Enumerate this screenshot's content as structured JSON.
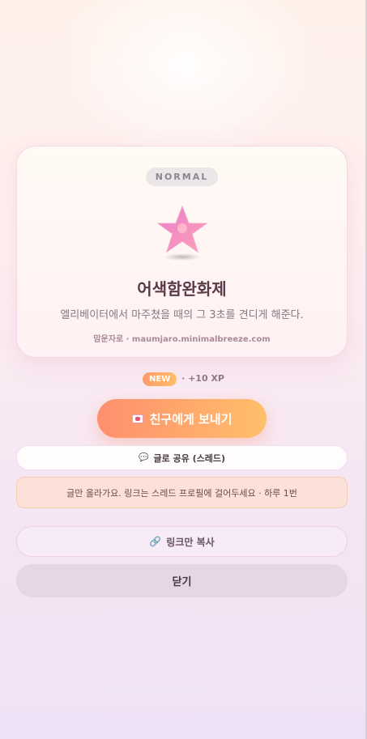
{
  "card": {
    "badge": "NORMAL",
    "title": "어색함완화제",
    "description": "엘리베이터에서 마주쳤을 때의 그 3초를 견디게 해준다.",
    "source": "맘운자로 · maumjaro.minimalbreeze.com",
    "icon": "pink-star-icon"
  },
  "reward": {
    "new_label": "NEW",
    "xp_text": "· +10 XP"
  },
  "actions": {
    "send_label": "친구에게 보내기",
    "share_label": "글로 공유 (스레드)",
    "notice": "글만 올라가요. 링크는 스레드 프로필에 걸어두세요 · 하루 1번",
    "copy_label": "링크만 복사",
    "close_label": "닫기"
  },
  "colors": {
    "accent_start": "#ff8f6e",
    "accent_end": "#ffbf6a",
    "star": "#f27fb2"
  }
}
